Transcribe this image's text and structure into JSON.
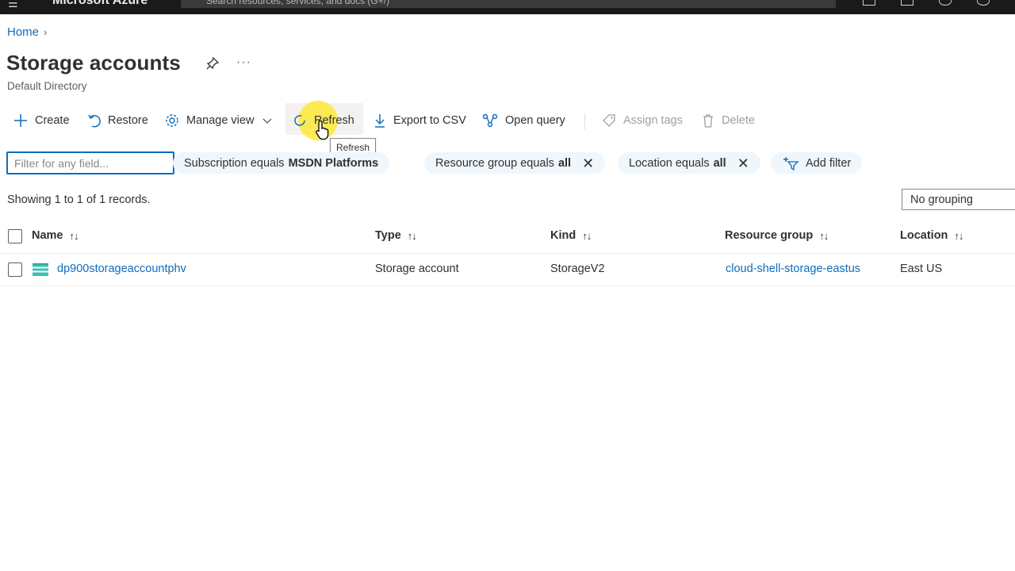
{
  "topbar": {
    "brand": "Microsoft Azure",
    "search_placeholder": "Search resources, services, and docs (G+/)"
  },
  "breadcrumb": {
    "home": "Home"
  },
  "page": {
    "title": "Storage accounts",
    "subtitle": "Default Directory",
    "more": "···"
  },
  "toolbar": {
    "create": "Create",
    "restore": "Restore",
    "manage_view": "Manage view",
    "refresh": "Refresh",
    "export_csv": "Export to CSV",
    "open_query": "Open query",
    "assign_tags": "Assign tags",
    "delete": "Delete",
    "tooltip": "Refresh"
  },
  "filters": {
    "search_placeholder": "Filter for any field...",
    "subscription_label": "Subscription equals",
    "subscription_value": "MSDN Platforms",
    "resource_group_label": "Resource group equals",
    "resource_group_value": "all",
    "location_label": "Location equals",
    "location_value": "all",
    "add_filter": "Add filter"
  },
  "records_text": "Showing 1 to 1 of 1 records.",
  "grouping": "No grouping",
  "table": {
    "headers": {
      "name": "Name",
      "type": "Type",
      "kind": "Kind",
      "resource_group": "Resource group",
      "location": "Location"
    },
    "rows": [
      {
        "name": "dp900storageaccountphv",
        "type": "Storage account",
        "kind": "StorageV2",
        "resource_group": "cloud-shell-storage-eastus",
        "location": "East US"
      }
    ]
  },
  "colors": {
    "accent": "#0f6cbd",
    "topbar": "#1b1a19",
    "pill_bg": "#eff6fc",
    "highlight": "#ffe61e"
  }
}
